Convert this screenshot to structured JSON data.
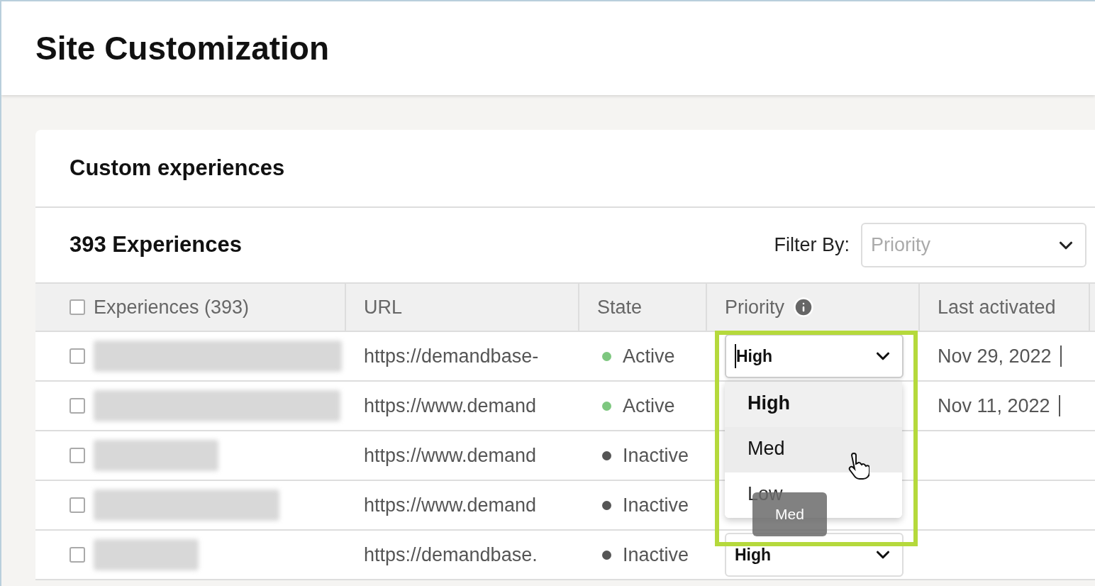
{
  "page": {
    "title": "Site Customization"
  },
  "card": {
    "title": "Custom experiences",
    "count": "393 Experiences",
    "filter": {
      "label": "Filter By:",
      "placeholder": "Priority"
    }
  },
  "table": {
    "select_all": {
      "checked": false
    },
    "columns": [
      {
        "label": "Experiences (393)"
      },
      {
        "label": "URL"
      },
      {
        "label": "State"
      },
      {
        "label": "Priority",
        "info": true
      },
      {
        "label": "Last activated"
      }
    ],
    "rows": [
      {
        "checked": false,
        "url": "https://demandbase-",
        "state": "Active",
        "color": "#7dc77f",
        "priority": {
          "value": "High",
          "open": true
        },
        "last_activated": "Nov 29, 2022"
      },
      {
        "checked": false,
        "url": "https://www.demand",
        "state": "Active",
        "color": "#7dc77f",
        "last_activated": "Nov 11, 2022"
      },
      {
        "checked": false,
        "url": "https://www.demand",
        "state": "Inactive",
        "color": "#555555"
      },
      {
        "checked": false,
        "url": "https://www.demand",
        "state": "Inactive",
        "color": "#555555"
      },
      {
        "checked": false,
        "url": "https://demandbase.",
        "state": "Inactive",
        "color": "#555555",
        "priority": {
          "value": "High",
          "open": false
        }
      }
    ]
  },
  "priority_menu": {
    "options": [
      {
        "label": "High",
        "selected": true,
        "hovered": false
      },
      {
        "label": "Med",
        "selected": false,
        "hovered": true
      },
      {
        "label": "Low",
        "selected": false,
        "hovered": false
      }
    ],
    "tooltip": "Med"
  }
}
